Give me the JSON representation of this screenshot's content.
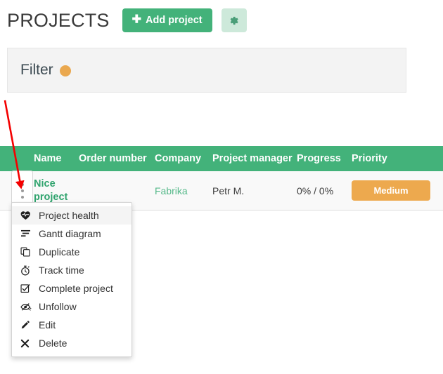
{
  "header": {
    "title": "PROJECTS",
    "add_button_label": "Add project",
    "add_button_icon": "plus-icon",
    "settings_icon": "gear-icon",
    "accent_green": "#43b27a",
    "settings_bg": "#cde9da"
  },
  "filter": {
    "label": "Filter",
    "indicator_icon": "filled-circle-icon",
    "indicator_color": "#eaa84f",
    "panel_bg": "#f3f3f3"
  },
  "table": {
    "columns": [
      "Name",
      "Order number",
      "Company",
      "Project manager",
      "Progress",
      "Priority"
    ],
    "header_bg": "#43b27a",
    "rows": [
      {
        "row_menu_icon": "kebab-menu-icon",
        "name": "Nice project",
        "order_number": "",
        "company": "Fabrika",
        "project_manager": "Petr M.",
        "progress": "0% / 0%",
        "priority": "Medium",
        "priority_color": "#eda94e"
      }
    ]
  },
  "context_menu": {
    "items": [
      {
        "label": "Project health",
        "icon": "heartbeat-icon",
        "highlighted": true
      },
      {
        "label": "Gantt diagram",
        "icon": "gantt-bars-icon",
        "highlighted": false
      },
      {
        "label": "Duplicate",
        "icon": "copy-icon",
        "highlighted": false
      },
      {
        "label": "Track time",
        "icon": "stopwatch-icon",
        "highlighted": false
      },
      {
        "label": "Complete project",
        "icon": "check-square-icon",
        "highlighted": false
      },
      {
        "label": "Unfollow",
        "icon": "eye-slash-icon",
        "highlighted": false
      },
      {
        "label": "Edit",
        "icon": "pencil-icon",
        "highlighted": false
      },
      {
        "label": "Delete",
        "icon": "times-icon",
        "highlighted": false
      }
    ]
  },
  "annotations": {
    "arrow_icon": "red-arrow-icon",
    "underline_target": "Gantt diagram",
    "color": "#f40000"
  }
}
